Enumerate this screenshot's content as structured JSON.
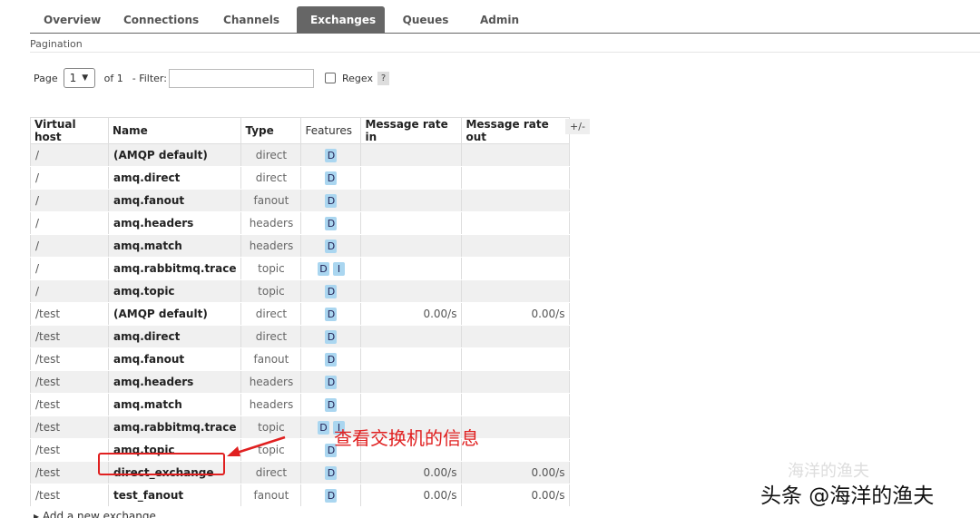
{
  "nav": {
    "tabs": [
      "Overview",
      "Connections",
      "Channels",
      "Exchanges",
      "Queues",
      "Admin"
    ],
    "active": "Exchanges"
  },
  "pagination": {
    "section_label": "Pagination",
    "page_label": "Page",
    "page_value": "1",
    "of_label": "of 1",
    "filter_label": "- Filter:",
    "filter_value": "",
    "regex_label": "Regex",
    "help_label": "?"
  },
  "table": {
    "columns": [
      "Virtual host",
      "Name",
      "Type",
      "Features",
      "Message rate in",
      "Message rate out"
    ],
    "toggle_label": "+/-",
    "rows": [
      {
        "vhost": "/",
        "name": "(AMQP default)",
        "type": "direct",
        "features": [
          "D"
        ],
        "rate_in": "",
        "rate_out": ""
      },
      {
        "vhost": "/",
        "name": "amq.direct",
        "type": "direct",
        "features": [
          "D"
        ],
        "rate_in": "",
        "rate_out": ""
      },
      {
        "vhost": "/",
        "name": "amq.fanout",
        "type": "fanout",
        "features": [
          "D"
        ],
        "rate_in": "",
        "rate_out": ""
      },
      {
        "vhost": "/",
        "name": "amq.headers",
        "type": "headers",
        "features": [
          "D"
        ],
        "rate_in": "",
        "rate_out": ""
      },
      {
        "vhost": "/",
        "name": "amq.match",
        "type": "headers",
        "features": [
          "D"
        ],
        "rate_in": "",
        "rate_out": ""
      },
      {
        "vhost": "/",
        "name": "amq.rabbitmq.trace",
        "type": "topic",
        "features": [
          "D",
          "I"
        ],
        "rate_in": "",
        "rate_out": ""
      },
      {
        "vhost": "/",
        "name": "amq.topic",
        "type": "topic",
        "features": [
          "D"
        ],
        "rate_in": "",
        "rate_out": ""
      },
      {
        "vhost": "/test",
        "name": "(AMQP default)",
        "type": "direct",
        "features": [
          "D"
        ],
        "rate_in": "0.00/s",
        "rate_out": "0.00/s"
      },
      {
        "vhost": "/test",
        "name": "amq.direct",
        "type": "direct",
        "features": [
          "D"
        ],
        "rate_in": "",
        "rate_out": ""
      },
      {
        "vhost": "/test",
        "name": "amq.fanout",
        "type": "fanout",
        "features": [
          "D"
        ],
        "rate_in": "",
        "rate_out": ""
      },
      {
        "vhost": "/test",
        "name": "amq.headers",
        "type": "headers",
        "features": [
          "D"
        ],
        "rate_in": "",
        "rate_out": ""
      },
      {
        "vhost": "/test",
        "name": "amq.match",
        "type": "headers",
        "features": [
          "D"
        ],
        "rate_in": "",
        "rate_out": ""
      },
      {
        "vhost": "/test",
        "name": "amq.rabbitmq.trace",
        "type": "topic",
        "features": [
          "D",
          "I"
        ],
        "rate_in": "",
        "rate_out": ""
      },
      {
        "vhost": "/test",
        "name": "amq.topic",
        "type": "topic",
        "features": [
          "D"
        ],
        "rate_in": "",
        "rate_out": ""
      },
      {
        "vhost": "/test",
        "name": "direct_exchange",
        "type": "direct",
        "features": [
          "D"
        ],
        "rate_in": "0.00/s",
        "rate_out": "0.00/s"
      },
      {
        "vhost": "/test",
        "name": "test_fanout",
        "type": "fanout",
        "features": [
          "D"
        ],
        "rate_in": "0.00/s",
        "rate_out": "0.00/s"
      }
    ]
  },
  "annotation": {
    "text": "查看交换机的信息",
    "color": "#e02020"
  },
  "watermark": {
    "text": "头条 @海洋的渔夫",
    "text_faint": "海洋的渔夫"
  },
  "footer": {
    "add_exchange": "▸ Add a new exchange"
  }
}
